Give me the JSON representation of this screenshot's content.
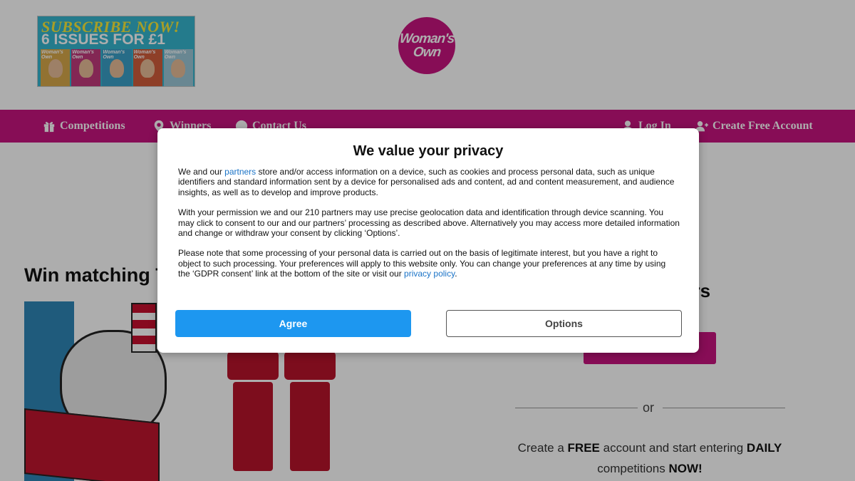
{
  "header": {
    "promo": {
      "line1": "SUBSCRIBE NOW!",
      "line2": "6 ISSUES FOR £1",
      "cover_masthead": "Woman's Own",
      "cover_colors": [
        "#d8a84a",
        "#c23a7c",
        "#3aa0c8",
        "#d25d3c",
        "#9bc7d8"
      ]
    },
    "logo": {
      "line1": "Woman's",
      "line2": "Own",
      "color": "#c8147f"
    }
  },
  "nav": {
    "color": "#c8147f",
    "items": [
      {
        "label": "Competitions",
        "icon": "gift-icon"
      },
      {
        "label": "Winners",
        "icon": "map-pin-icon"
      },
      {
        "label": "Contact Us",
        "icon": "question-circle-icon"
      },
      {
        "label": "Log In",
        "icon": "user-icon"
      },
      {
        "label": "Create Free Account",
        "icon": "user-plus-icon"
      }
    ]
  },
  "main": {
    "competition_title": "Win matching T",
    "right_heading": "ers",
    "or_text": "or",
    "create": {
      "part1": "Create a ",
      "free": "FREE",
      "part2": " account and start entering ",
      "daily": "DAILY",
      "part3": "competitions ",
      "now": "NOW!"
    }
  },
  "consent": {
    "title": "We value your privacy",
    "p1_before": "We and our ",
    "p1_link": "partners",
    "p1_after": " store and/or access information on a device, such as cookies and process personal data, such as unique identifiers and standard information sent by a device for personalised ads and content, ad and content measurement, and audience insights, as well as to develop and improve products.",
    "p2": "With your permission we and our 210 partners may use precise geolocation data and identification through device scanning. You may click to consent to our and our partners’ processing as described above. Alternatively you may access more detailed information and change or withdraw your consent by clicking ‘Options’.",
    "p3_before": "Please note that some processing of your personal data is carried out on the basis of legitimate interest, but you have a right to object to such processing. Your preferences will apply to this website only. You can change your preferences at any time by using the ‘GDPR consent’ link at the bottom of the site or visit our ",
    "p3_link": "privacy policy",
    "p3_after": ".",
    "agree_label": "Agree",
    "options_label": "Options",
    "agree_color": "#1d97f0",
    "link_color": "#1a73c7"
  }
}
